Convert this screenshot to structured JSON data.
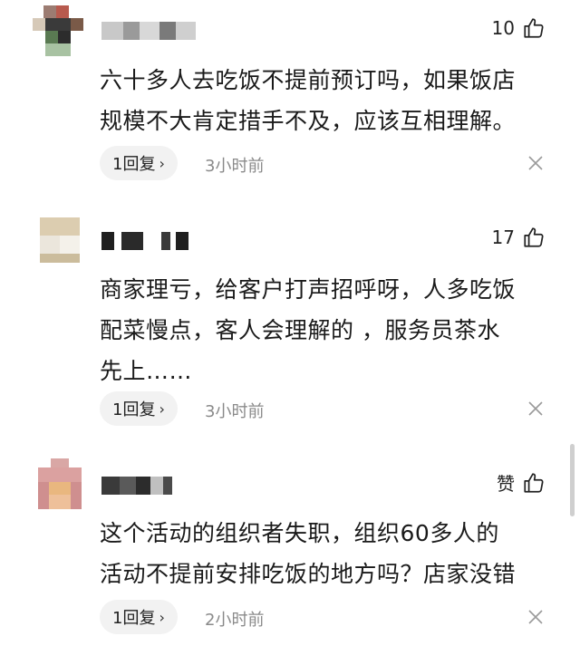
{
  "comments": [
    {
      "likes": "10",
      "text_lines": [
        "六十多人去吃饭不提前预订吗，如果饭店",
        "规模不大肯定措手不及，应该互相理解。"
      ],
      "reply_label": "1回复",
      "time": "3小时前",
      "avatar_colors": [
        "#b28a7a",
        "#6b4b3a",
        "#c25b4d",
        "#3e5a3a",
        "#8fae8c",
        "#2e2e2e"
      ]
    },
    {
      "likes": "17",
      "text_lines": [
        "商家理亏，给客户打声招呼呀，人多吃饭",
        "配菜慢点，客人会理解的 ，服务员茶水",
        "先上……"
      ],
      "reply_label": "1回复",
      "time": "3小时前",
      "avatar_colors": [
        "#d9c9a8",
        "#e8e2d6",
        "#c9b58f",
        "#f0ece4"
      ]
    },
    {
      "likes": "赞",
      "text_lines": [
        "这个活动的组织者失职，组织60多人的",
        "活动不提前安排吃饭的地方吗？店家没错"
      ],
      "reply_label": "1回复",
      "time": "2小时前",
      "avatar_colors": [
        "#d89a9a",
        "#e2b27a",
        "#c97a7a",
        "#f0c9a2"
      ]
    }
  ],
  "icons": {
    "like": "thumbs-up-icon",
    "chevron": "chevron-right-icon",
    "close": "close-icon"
  }
}
